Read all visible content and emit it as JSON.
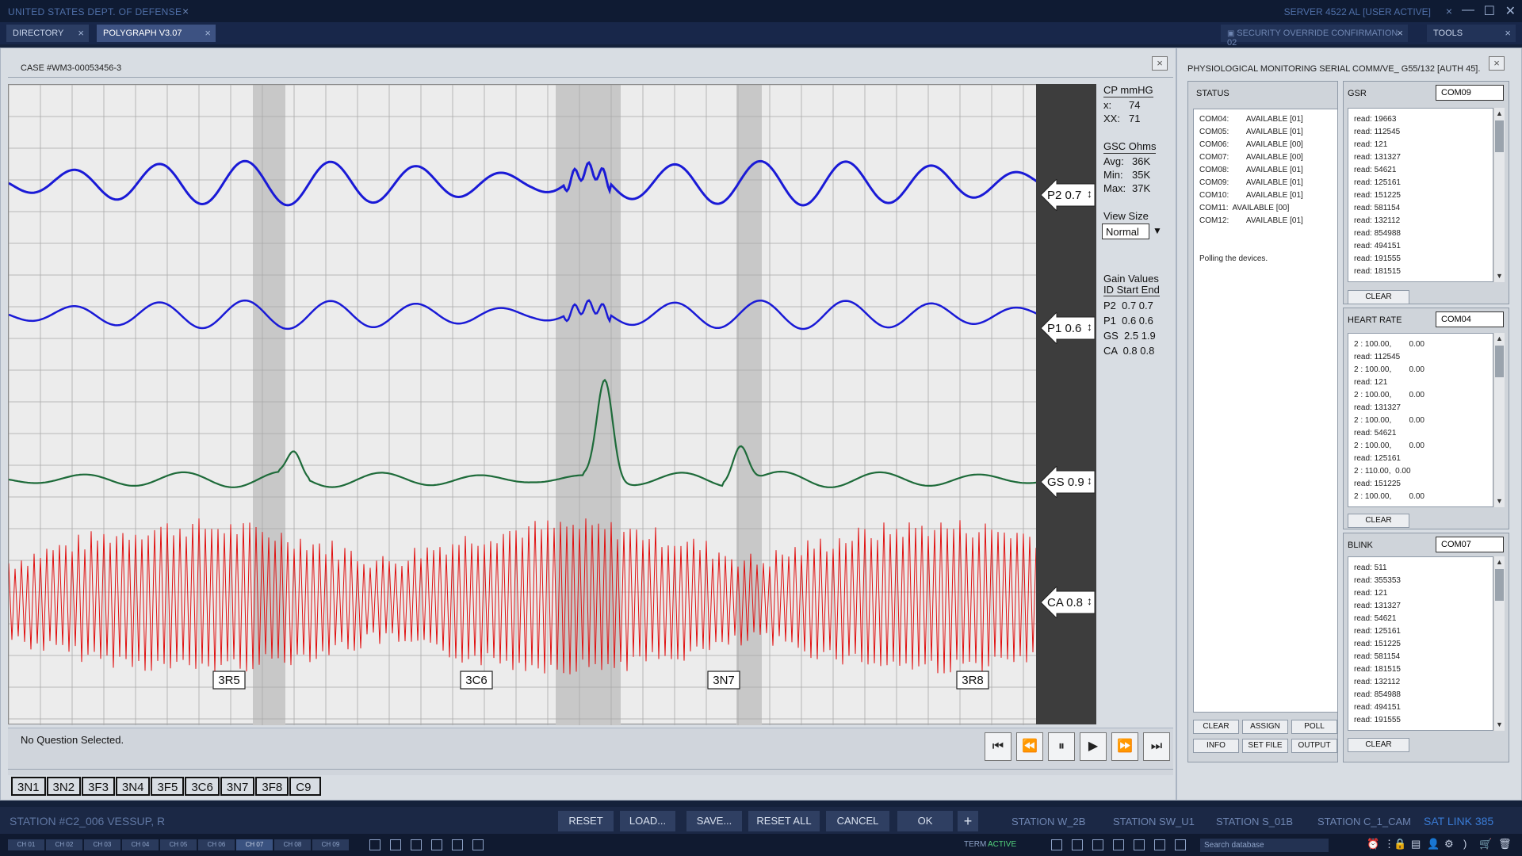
{
  "titlebar": {
    "left": "UNITED STATES DEPT. OF DEFENSE",
    "right": "SERVER 4522 AL [USER ACTIVE]"
  },
  "tabs": [
    {
      "label": "DIRECTORY"
    },
    {
      "label": "POLYGRAPH V3.07"
    }
  ],
  "right_tabs": [
    {
      "label": "SECURITY OVERRIDE CONFIRMATION 02"
    },
    {
      "label": "TOOLS"
    }
  ],
  "case_title": "CASE #WM3-00053456-3",
  "info": {
    "cp_title": "CP mmHG",
    "cp_x_label": "x:",
    "cp_x_value": "74",
    "cp_xx_label": "XX:",
    "cp_xx_value": "71",
    "gsc_title": "GSC Ohms",
    "avg_label": "Avg:",
    "avg_value": "36K",
    "min_label": "Min:",
    "min_value": "35K",
    "max_label": "Max:",
    "max_value": "37K",
    "view_size_label": "View Size",
    "view_size_value": "Normal",
    "gain_title": "Gain Values",
    "gain_header": "ID Start End",
    "gain_rows": [
      "P2  0.7 0.7",
      "P1  0.6 0.6",
      "GS  2.5 1.9",
      "CA  0.8 0.8"
    ]
  },
  "channel_labels": [
    "P2 0.7",
    "P1  0.6",
    "GS 0.9",
    "CA 0.8"
  ],
  "question_markers": [
    "3R5",
    "3C6",
    "3N7",
    "3R8"
  ],
  "status_text": "No Question Selected.",
  "question_tabs": [
    "3N1",
    "3N2",
    "3F3",
    "3N4",
    "3F5",
    "3C6",
    "3N7",
    "3F8",
    "C9"
  ],
  "right_panel": {
    "title": "PHYSIOLOGICAL MONITORING SERIAL COMM/VE_ G55/132 [AUTH 45].",
    "status_label": "STATUS",
    "status_lines": [
      "COM04:        AVAILABLE [01]",
      "COM05:        AVAILABLE [01]",
      "COM06:        AVAILABLE [00]",
      "COM07:        AVAILABLE [00]",
      "COM08:        AVAILABLE [01]",
      "COM09:        AVAILABLE [01]",
      "COM10:        AVAILABLE [01]",
      "COM11:  AVAILABLE [00]",
      "COM12:        AVAILABLE [01]",
      "",
      "",
      "Polling the devices."
    ],
    "status_buttons": [
      "CLEAR",
      "ASSIGN",
      "POLL",
      "INFO",
      "SET FILE",
      "OUTPUT"
    ],
    "gsr_label": "GSR",
    "gsr_com": "COM09",
    "gsr_lines": [
      "read: 19663",
      "read: 112545",
      "read: 121",
      "read: 131327",
      "read: 54621",
      "read: 125161",
      "read: 151225",
      "read: 581154",
      "read: 132112",
      "read: 854988",
      "read: 494151",
      "read: 191555",
      "read: 181515"
    ],
    "hr_label": "HEART RATE",
    "hr_com": "COM04",
    "hr_lines": [
      "2 : 100.00,        0.00",
      "read: 112545",
      "2 : 100.00,        0.00",
      "read: 121",
      "2 : 100.00,        0.00",
      "read: 131327",
      "2 : 100.00,        0.00",
      "read: 54621",
      "2 : 100.00,        0.00",
      "read: 125161",
      "2 : 110.00,  0.00",
      "read: 151225",
      "2 : 100.00,        0.00"
    ],
    "blink_label": "BLINK",
    "blink_com": "COM07",
    "blink_lines": [
      "read: 511",
      "read: 355353",
      "read: 121",
      "read: 131327",
      "read: 54621",
      "read: 125161",
      "read: 151225",
      "read: 581154",
      "read: 181515",
      "read: 132112",
      "read: 854988",
      "read: 494151",
      "read: 191555"
    ],
    "clear_label": "CLEAR"
  },
  "bottom": {
    "station": "STATION #C2_006  VESSUP, R",
    "buttons": [
      "RESET",
      "LOAD...",
      "SAVE...",
      "RESET ALL",
      "CANCEL",
      "OK"
    ],
    "plus": "+",
    "stations": [
      "STATION W_2B",
      "STATION SW_U1",
      "STATION S_01B",
      "STATION C_1_CAM"
    ],
    "sat_link": "SAT LINK 385"
  },
  "taskbar": {
    "channels": [
      "CH 01",
      "CH 02",
      "CH 03",
      "CH 04",
      "CH 05",
      "CH 06",
      "CH 07",
      "CH 08",
      "CH 09"
    ],
    "term_label": "TERM",
    "term_status": "ACTIVE",
    "search_placeholder": "Search database"
  },
  "colors": {
    "p_trace": "#1a1ad6",
    "gs_trace": "#1e6b3a",
    "ca_trace": "#e01010",
    "accent": "#3a7bd5"
  }
}
